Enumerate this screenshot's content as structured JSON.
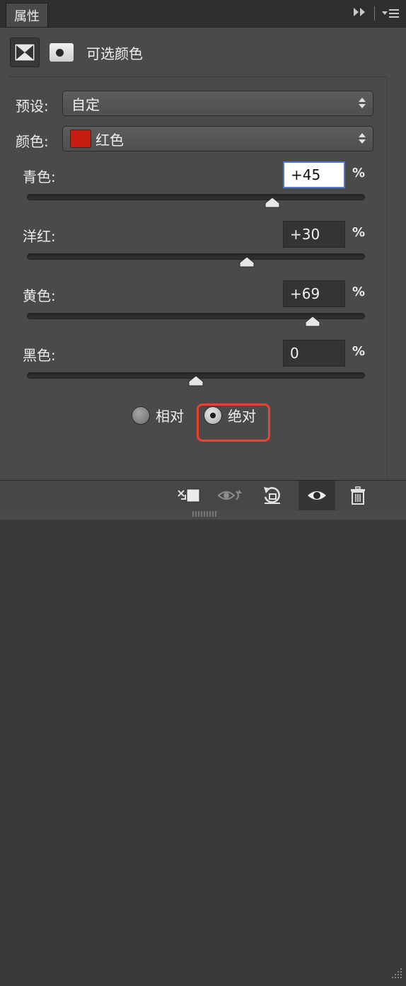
{
  "tab": {
    "label": "属性"
  },
  "header": {
    "title": "可选颜色"
  },
  "preset": {
    "label": "预设:",
    "value": "自定"
  },
  "color": {
    "label": "颜色:",
    "value": "红色",
    "swatch": "#c81e12"
  },
  "sliders": [
    {
      "label": "青色:",
      "value": "+45",
      "percent": "%",
      "position": 0.725,
      "active": true
    },
    {
      "label": "洋红:",
      "value": "+30",
      "percent": "%",
      "position": 0.65,
      "active": false
    },
    {
      "label": "黄色:",
      "value": "+69",
      "percent": "%",
      "position": 0.845,
      "active": false
    },
    {
      "label": "黑色:",
      "value": "0",
      "percent": "%",
      "position": 0.5,
      "active": false
    }
  ],
  "method": {
    "options": [
      {
        "label": "相对",
        "checked": false
      },
      {
        "label": "绝对",
        "checked": true
      }
    ],
    "highlight_color": "#e8432c"
  },
  "toolbar": {
    "icons": [
      "clip-to-layer-icon",
      "visibility-toggle-icon",
      "reset-icon",
      "eye-icon",
      "trash-icon"
    ]
  },
  "colors": {
    "panel_bg": "#4a4a4a",
    "field_bg": "#343434",
    "active_border": "#4d78c8"
  }
}
